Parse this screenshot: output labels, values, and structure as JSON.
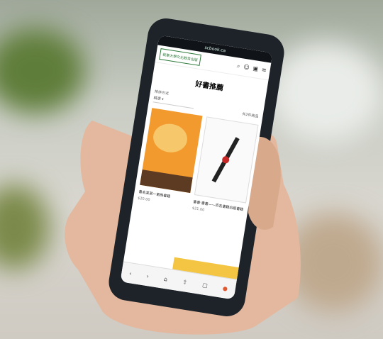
{
  "status": {
    "url": "scbook.ca"
  },
  "header": {
    "logo_text": "我華大學文化教育出版",
    "icons": [
      "search-icon",
      "user-icon",
      "cart-icon",
      "menu-icon"
    ]
  },
  "page": {
    "title": "好書推薦"
  },
  "filters": {
    "label_left": "排序方式",
    "select_value": "精選",
    "result_count": "共2件商品"
  },
  "products": [
    {
      "name": "書名某某一第冊書籍",
      "price": "$20.00"
    },
    {
      "name": "書書·書書——百名書籍出版書籍",
      "price": "$21.00"
    }
  ],
  "bottom_nav": [
    "back-icon",
    "forward-icon",
    "home-icon",
    "share-icon",
    "tabs-icon",
    "more-icon"
  ]
}
